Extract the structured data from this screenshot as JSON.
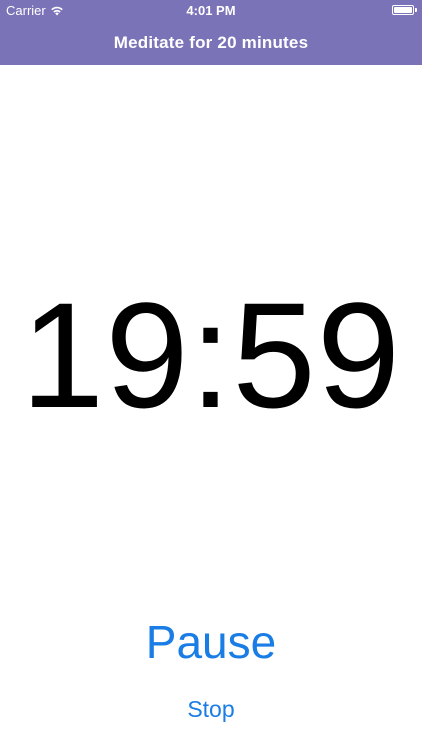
{
  "status_bar": {
    "carrier": "Carrier",
    "wifi_icon": "wifi-icon",
    "time": "4:01 PM",
    "battery_icon": "battery-icon",
    "battery_level": 1.0
  },
  "header": {
    "title": "Meditate for 20 minutes",
    "background_color": "#7a73b8"
  },
  "timer": {
    "display": "19:59"
  },
  "controls": {
    "pause_label": "Pause",
    "stop_label": "Stop",
    "accent_color": "#1a7de6"
  }
}
